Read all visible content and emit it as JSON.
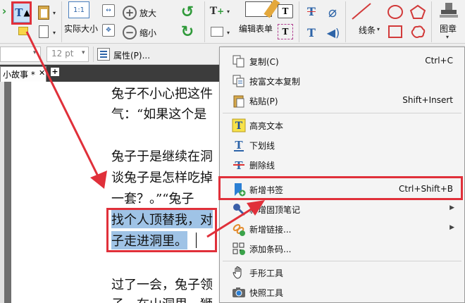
{
  "ribbon": {
    "actual_size_label": "实际大小",
    "zoom_in_label": "放大",
    "zoom_out_label": "缩小",
    "edit_form_label": "编辑表单",
    "lines_label": "线条",
    "stamp_label": "图章",
    "stamp_dropdown": "▾"
  },
  "formatbar": {
    "font_size_value": "12 pt",
    "font_size_dropdown": "▾",
    "properties_label": "属性(P)..."
  },
  "tabs": {
    "active_label": "小故事 *",
    "close_glyph": "✕",
    "add_glyph": "+"
  },
  "document": {
    "lines": [
      "兔子不小心把这件",
      "气：“如果这个是",
      "兔子于是继续在洞",
      "谈兔子是怎样吃掉",
      "一套？。”“兔子",
      "找个人顶替我，对",
      "子走进洞里。",
      "过了一会，兔子领",
      "子，在山洞里，狮"
    ]
  },
  "context_menu": {
    "items": [
      {
        "label": "复制(C)",
        "shortcut": "Ctrl+C",
        "icon": "copy-icon"
      },
      {
        "label": "按富文本复制",
        "shortcut": "",
        "icon": "rich-text-copy-icon"
      },
      {
        "label": "粘贴(P)",
        "shortcut": "Shift+Insert",
        "icon": "paste-icon"
      },
      {
        "label": "高亮文本",
        "shortcut": "",
        "icon": "highlight-text-icon"
      },
      {
        "label": "下划线",
        "shortcut": "",
        "icon": "underline-icon"
      },
      {
        "label": "删除线",
        "shortcut": "",
        "icon": "strikeout-icon"
      },
      {
        "label": "新增书签",
        "shortcut": "Ctrl+Shift+B",
        "icon": "bookmark-icon"
      },
      {
        "label": "新增固顶笔记",
        "shortcut": "",
        "icon": "pin-note-icon",
        "submenu": true
      },
      {
        "label": "新增链接...",
        "shortcut": "",
        "icon": "link-icon",
        "submenu": true
      },
      {
        "label": "添加条码...",
        "shortcut": "",
        "icon": "barcode-icon"
      },
      {
        "label": "手形工具",
        "shortcut": "",
        "icon": "hand-tool-icon"
      },
      {
        "label": "快照工具",
        "shortcut": "",
        "icon": "snapshot-icon"
      }
    ],
    "submenu_arrow": "▶"
  },
  "colors": {
    "annotation_red": "#e0303a",
    "selection_blue": "#9fc3e6",
    "bookmark_blue": "#2b7fd4"
  }
}
